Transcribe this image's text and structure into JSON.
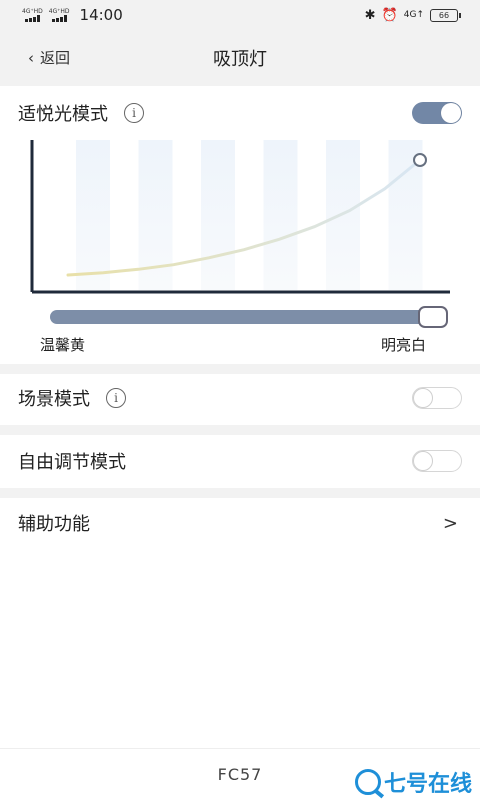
{
  "status_bar": {
    "net1": "4G⁺HD",
    "net2": "4G⁺HD",
    "time": "14:00",
    "net3": "4G↑",
    "battery": "66"
  },
  "header": {
    "back_label": "返回",
    "title": "吸顶灯"
  },
  "comfort_mode": {
    "label": "适悦光模式",
    "info": "i",
    "enabled": true,
    "slider_value": 1.0,
    "min_label": "温馨黄",
    "max_label": "明亮白"
  },
  "chart_data": {
    "type": "line",
    "title": "",
    "xlabel": "",
    "ylabel": "",
    "band_count": 6,
    "series": [
      {
        "x": [
          0,
          0.1,
          0.2,
          0.3,
          0.4,
          0.5,
          0.6,
          0.7,
          0.8,
          0.9,
          1.0
        ],
        "values": [
          0.0,
          0.02,
          0.05,
          0.09,
          0.15,
          0.22,
          0.31,
          0.42,
          0.56,
          0.75,
          1.0
        ]
      }
    ],
    "marker_at": 1.0,
    "grid": false
  },
  "scene_mode": {
    "label": "场景模式",
    "info": "i",
    "enabled": false
  },
  "free_mode": {
    "label": "自由调节模式",
    "enabled": false
  },
  "assist": {
    "label": "辅助功能",
    "chevron": ">"
  },
  "footer": {
    "model": "FC57"
  },
  "watermark": {
    "text": "七号在线"
  },
  "colors": {
    "toggle_on": "#7287a6",
    "slider": "#7d8ea8",
    "watermark": "#1e8fd8"
  }
}
